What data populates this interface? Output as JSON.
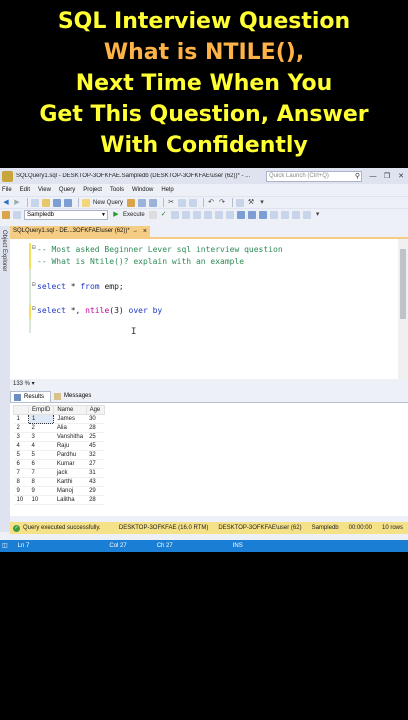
{
  "headline": {
    "line1": "SQL Interview Question",
    "line2": "What is NTILE(),",
    "line3": "Next Time When You",
    "line4": "Get This Question, Answer",
    "line5": "With Confidently"
  },
  "window": {
    "title": "SQLQuery1.sql - DESKTOP-3OFKFAE.Sampledb (DESKTOP-3OFKFAE\\user (62))* - ...",
    "quick_launch_placeholder": "Quick Launch (Ctrl+Q)",
    "minimize": "—",
    "restore": "❐",
    "close": "✕"
  },
  "menu": [
    "File",
    "Edit",
    "View",
    "Query",
    "Project",
    "Tools",
    "Window",
    "Help"
  ],
  "toolbar": {
    "new_query": "New Query",
    "database": "Sampledb",
    "execute": "Execute"
  },
  "object_explorer_label": "Object Explorer",
  "doc_tab": {
    "label": "SQLQuery1.sql - DE...3OFKFAE\\user (62))*",
    "pin": "→",
    "close": "×"
  },
  "editor": {
    "lines": [
      {
        "text": "-- Most asked Beginner Lever sql interview question",
        "kind": "comment"
      },
      {
        "text": "-- What is Ntile()? explain with an example",
        "kind": "comment"
      },
      {
        "text": "select * from emp;",
        "kind": "code"
      },
      {
        "text": "select *, ntile(3) over by",
        "kind": "code"
      }
    ]
  },
  "zoom": "133 %",
  "result_tabs": {
    "results": "Results",
    "messages": "Messages"
  },
  "grid": {
    "columns": [
      "EmpID",
      "Name",
      "Age"
    ],
    "rows": [
      {
        "n": "1",
        "id": "1",
        "name": "James",
        "age": "30"
      },
      {
        "n": "2",
        "id": "2",
        "name": "Alia",
        "age": "28"
      },
      {
        "n": "3",
        "id": "3",
        "name": "Vanshitha",
        "age": "25"
      },
      {
        "n": "4",
        "id": "4",
        "name": "Raju",
        "age": "45"
      },
      {
        "n": "5",
        "id": "5",
        "name": "Pardhu",
        "age": "32"
      },
      {
        "n": "6",
        "id": "6",
        "name": "Kumar",
        "age": "27"
      },
      {
        "n": "7",
        "id": "7",
        "name": "jack",
        "age": "31"
      },
      {
        "n": "8",
        "id": "8",
        "name": "Karthi",
        "age": "43"
      },
      {
        "n": "9",
        "id": "9",
        "name": "Manoj",
        "age": "29"
      },
      {
        "n": "10",
        "id": "10",
        "name": "Lalitha",
        "age": "28"
      }
    ]
  },
  "query_status": {
    "message": "Query executed successfully.",
    "server": "DESKTOP-3OFKFAE (16.0 RTM)",
    "user": "DESKTOP-3OFKFAE\\user (62)",
    "db": "Sampledb",
    "time": "00:00:00",
    "rows": "10 rows"
  },
  "app_status": {
    "ln": "Ln 7",
    "col": "Col 27",
    "ch": "Ch 27",
    "ins": "INS"
  },
  "colors": {
    "headline_yellow": "#ffff33",
    "headline_orange": "#ffb347",
    "status_blue": "#1a7fd4",
    "query_status_yellow": "#f5e187",
    "doc_tab": "#f5cc84"
  }
}
